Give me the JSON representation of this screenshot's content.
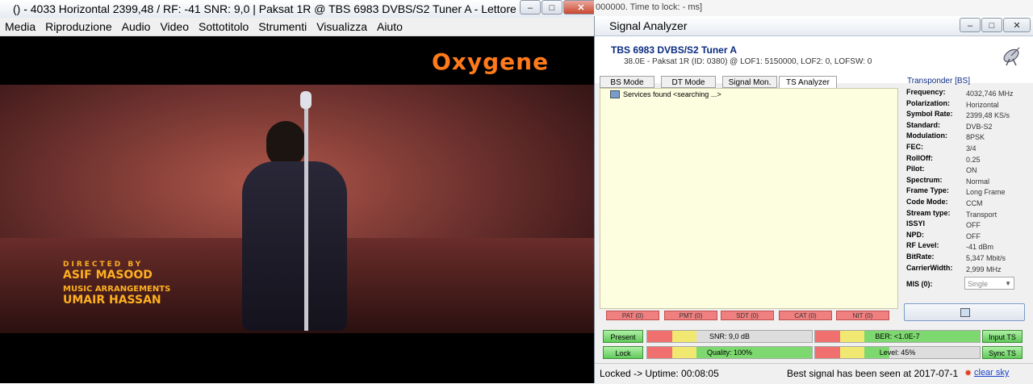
{
  "vlc": {
    "title": "() - 4033 Horizontal 2399,48 / RF: -41 SNR: 9,0 | Paksat 1R @ TBS 6983 DVBS/S2 Tuner A - Lettore multimediale VLC",
    "menu": [
      "Media",
      "Riproduzione",
      "Audio",
      "Video",
      "Sottotitolo",
      "Strumenti",
      "Visualizza",
      "Aiuto"
    ],
    "video": {
      "logo": "Oxygene",
      "credits": {
        "line1": "DIRECTED BY",
        "line2": "ASIF MASOOD",
        "line3": "MUSIC ARRANGEMENTS",
        "line4": "UMAIR HASSAN"
      }
    }
  },
  "background_app": {
    "text": "000000. Time to lock: - ms]"
  },
  "sa": {
    "title": "Signal Analyzer",
    "device": "TBS 6983 DVBS/S2 Tuner A",
    "satellite": "38.0E - Paksat 1R (ID: 0380) @ LOF1: 5150000, LOF2: 0, LOFSW: 0",
    "tabs": [
      "BS Mode",
      "DT Mode",
      "Signal Mon.",
      "TS Analyzer (OK"
    ],
    "tree_item": "Services found <searching ...>",
    "packets": [
      "PAT (0)",
      "PMT (0)",
      "SDT (0)",
      "CAT (0)",
      "NIT (0)"
    ],
    "transponder": {
      "title": "Transponder [BS]",
      "rows": [
        {
          "label": "Frequency:",
          "value": "4032,746 MHz"
        },
        {
          "label": "Polarization:",
          "value": "Horizontal"
        },
        {
          "label": "Symbol Rate:",
          "value": "2399,48 KS/s"
        },
        {
          "label": "Standard:",
          "value": "DVB-S2"
        },
        {
          "label": "Modulation:",
          "value": "8PSK"
        },
        {
          "label": "FEC:",
          "value": "3/4"
        },
        {
          "label": "RollOff:",
          "value": "0.25"
        },
        {
          "label": "Pilot:",
          "value": "ON"
        },
        {
          "label": "Spectrum:",
          "value": "Normal"
        },
        {
          "label": "Frame Type:",
          "value": "Long Frame"
        },
        {
          "label": "Code Mode:",
          "value": "CCM"
        },
        {
          "label": "Stream type:",
          "value": "Transport"
        },
        {
          "label": "ISSYI",
          "value": "OFF"
        },
        {
          "label": "NPD:",
          "value": "OFF"
        },
        {
          "label": "RF Level:",
          "value": "-41 dBm"
        },
        {
          "label": "BitRate:",
          "value": "5,347 Mbit/s"
        },
        {
          "label": "CarrierWidth:",
          "value": "2,999 MHz"
        }
      ],
      "mis_label": "MIS (0):",
      "mis_value": "Single"
    },
    "buttons": {
      "present": "Present",
      "lock": "Lock",
      "input_ts": "Input TS",
      "sync_ts": "Sync TS"
    },
    "meters": {
      "snr": {
        "label": "SNR: 9,0 dB",
        "fraction": 0.3
      },
      "ber": {
        "label": "BER: <1.0E-7",
        "fraction": 1.0
      },
      "quality": {
        "label": "Quality: 100%",
        "fraction": 1.0
      },
      "level": {
        "label": "Level: 45%",
        "fraction": 0.45
      }
    },
    "status": {
      "left": "Locked -> Uptime: 00:08:05",
      "mid": "Best signal has been seen at 2017-07-1",
      "right": "clear sky"
    }
  }
}
